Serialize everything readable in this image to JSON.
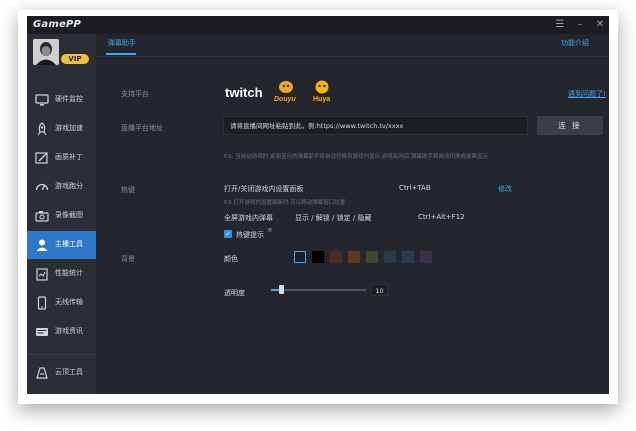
{
  "app": {
    "logo": "GamePP"
  },
  "window_controls": {
    "menu": "☰",
    "minimize": "–",
    "close": "✕"
  },
  "user": {
    "badge": "VIP"
  },
  "sidebar": {
    "items": [
      {
        "label": "硬件监控",
        "icon": "monitor-icon"
      },
      {
        "label": "游戏加速",
        "icon": "rocket-icon"
      },
      {
        "label": "画质补丁",
        "icon": "brush-icon"
      },
      {
        "label": "游戏跑分",
        "icon": "speedometer-icon"
      },
      {
        "label": "录像截图",
        "icon": "camera-icon"
      },
      {
        "label": "主播工具",
        "icon": "user-icon"
      },
      {
        "label": "性能统计",
        "icon": "clipboard-icon"
      },
      {
        "label": "无线传输",
        "icon": "phone-icon"
      },
      {
        "label": "游戏资讯",
        "icon": "news-icon"
      }
    ],
    "bottom_item": {
      "label": "云顶工具",
      "icon": "game-icon"
    }
  },
  "tabs": {
    "active": "弹幕助手"
  },
  "header_link": "功能介绍",
  "platforms": {
    "label": "支持平台",
    "names": [
      "twitch",
      "Douyu",
      "Huya"
    ],
    "problem_link": "遇到问题了!"
  },
  "live_address": {
    "label": "直播平台地址",
    "placeholder": "请将直播间网址粘贴到此。例:https://www.twitch.tv/xxxx",
    "button": "连 接",
    "note": "P.S. 当自动游戏时,桌面显示的弹幕助手将自动切换到游戏内显示;游戏关闭后,弹幕助手将自动切换成桌面显示"
  },
  "hotkey": {
    "label": "热键",
    "row1_name": "打开/关闭游戏内设置面板",
    "row1_key": "Ctrl+TAB",
    "modify": "修改",
    "row1_hint": "P.S.打开游戏内设置面板时,可以移动弹幕窗口位置",
    "row2_name": "全屏游戏内弹幕",
    "row2_actions": "显示 / 解锁 / 锁定 / 隐藏",
    "row2_key": "Ctrl+Alt+F12",
    "tip_label": "热键提示",
    "tip_checked": true
  },
  "background": {
    "label": "背景",
    "color_label": "颜色",
    "swatches": [
      "#1c1e23",
      "#000000",
      "#4a2a22",
      "#5a3a22",
      "#3a4a2a",
      "#2a3a4a",
      "#2a3a55",
      "#3a2f4a"
    ],
    "opacity_label": "透明度",
    "opacity_value": "10"
  },
  "colors": {
    "accent": "#3fa9f5",
    "active_nav": "#2f77c9",
    "vip": "#f2c12e",
    "twitch": "#9146ff",
    "douyu": "#f5a623",
    "huya": "#ffb400"
  }
}
